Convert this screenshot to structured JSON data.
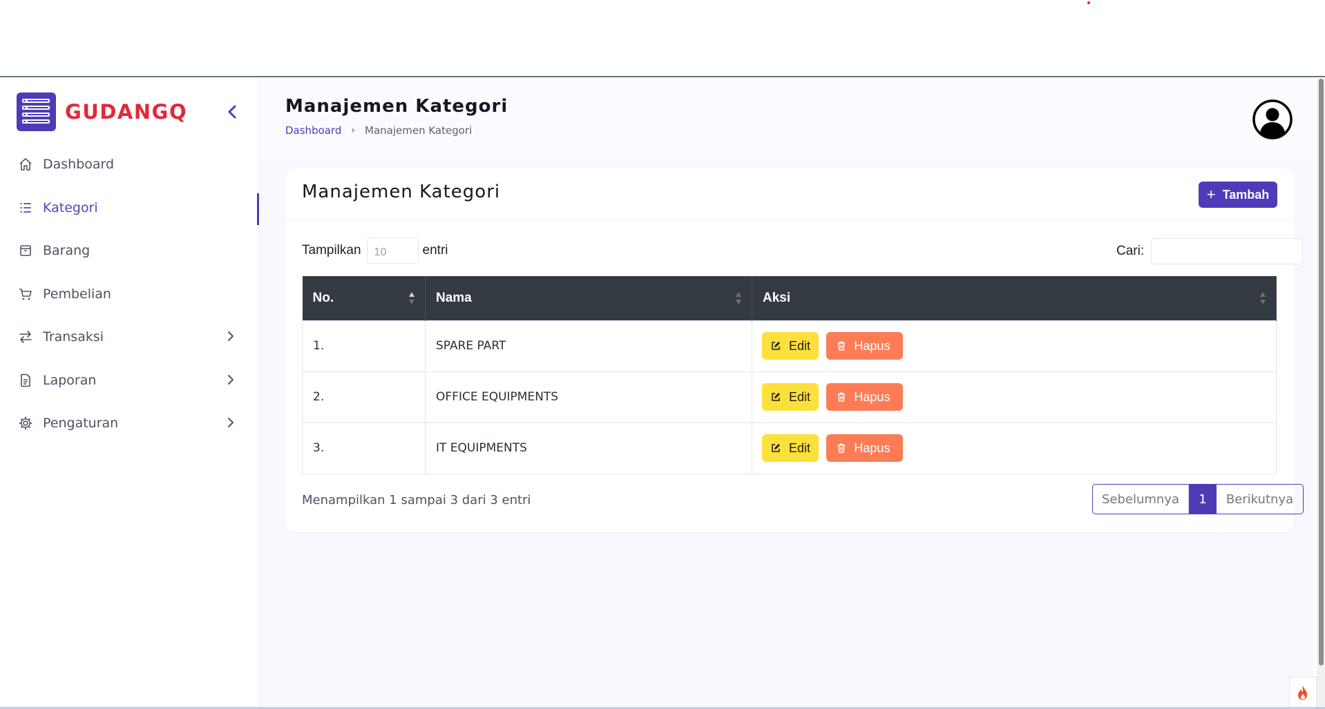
{
  "brand": {
    "name": "GUDANGQ"
  },
  "sidebar": {
    "items": [
      {
        "label": "Dashboard",
        "icon": "home-icon"
      },
      {
        "label": "Kategori",
        "icon": "list-icon",
        "active": true
      },
      {
        "label": "Barang",
        "icon": "box-icon"
      },
      {
        "label": "Pembelian",
        "icon": "cart-icon"
      },
      {
        "label": "Transaksi",
        "icon": "transfer-icon",
        "has_submenu": true
      },
      {
        "label": "Laporan",
        "icon": "document-icon",
        "has_submenu": true
      },
      {
        "label": "Pengaturan",
        "icon": "gear-icon",
        "has_submenu": true
      }
    ]
  },
  "header": {
    "title": "Manajemen Kategori",
    "breadcrumb": {
      "home": "Dashboard",
      "separator": "›",
      "current": "Manajemen Kategori"
    }
  },
  "card": {
    "title": "Manajemen Kategori",
    "add_button": "Tambah",
    "length": {
      "label_before": "Tampilkan",
      "placeholder": "10",
      "label_after": "entri"
    },
    "search": {
      "label": "Cari:",
      "value": ""
    },
    "table": {
      "columns": [
        "No.",
        "Nama",
        "Aksi"
      ],
      "rows": [
        {
          "no": "1.",
          "nama": "SPARE PART"
        },
        {
          "no": "2.",
          "nama": "OFFICE EQUIPMENTS"
        },
        {
          "no": "3.",
          "nama": "IT EQUIPMENTS"
        }
      ],
      "edit_label": "Edit",
      "delete_label": "Hapus"
    },
    "info": "Menampilkan 1 sampai 3 dari 3 entri",
    "pagination": {
      "prev": "Sebelumnya",
      "current": "1",
      "next": "Berikutnya"
    }
  },
  "colors": {
    "accent": "#4f3ab8",
    "brand": "#e02a3a",
    "edit": "#fde03b",
    "delete": "#fd7c56",
    "table_header": "#343a42"
  }
}
